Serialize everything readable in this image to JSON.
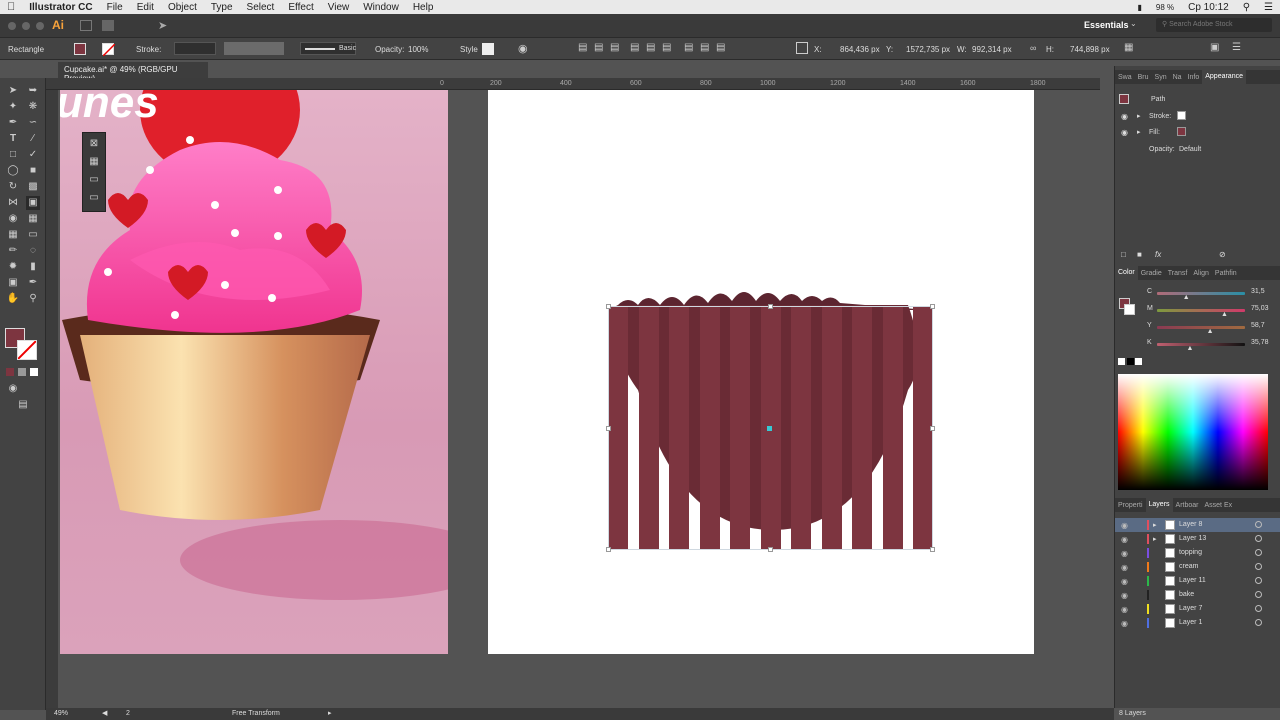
{
  "menubar": {
    "apple_icon": "apple-logo-icon",
    "app_name": "Illustrator CC",
    "items": [
      "File",
      "Edit",
      "Object",
      "Type",
      "Select",
      "Effect",
      "View",
      "Window",
      "Help"
    ],
    "battery": "98 %",
    "clock": "Ср 10:12"
  },
  "approw": {
    "ai_badge": "Ai",
    "workspace": "Essentials",
    "search_placeholder": "Search Adobe Stock"
  },
  "control": {
    "object_type": "Rectangle",
    "stroke_label": "Stroke:",
    "brush_label": "Basic",
    "opacity_label": "Opacity:",
    "opacity_value": "100%",
    "style_label": "Style",
    "x_label": "X:",
    "x_value": "864,436 px",
    "y_label": "Y:",
    "y_value": "1572,735 px",
    "w_label": "W:",
    "w_value": "992,314 px",
    "h_label": "H:",
    "h_value": "744,898 px"
  },
  "document": {
    "tab_title": "Cupcake.ai* @ 49% (RGB/GPU Preview)",
    "left_art_text": "unes",
    "ruler_labels": [
      "0",
      "200",
      "400",
      "600",
      "800",
      "1000",
      "1200",
      "1400",
      "1600",
      "1800"
    ]
  },
  "colors": {
    "fill": "#7d3540",
    "fill_dark": "#6a2b35",
    "wave": "#5c2530",
    "accent": "#37c9d3"
  },
  "appearance_panel": {
    "tabs": [
      "Swa",
      "Bru",
      "Syn",
      "Na",
      "Info",
      "Appearance"
    ],
    "active_tab": "Appearance",
    "object": "Path",
    "stroke_label": "Stroke:",
    "fill_label": "Fill:",
    "opacity_label": "Opacity:",
    "opacity_value": "Default"
  },
  "color_panel": {
    "tabs": [
      "Color",
      "Gradie",
      "Transf",
      "Align",
      "Pathfin"
    ],
    "active_tab": "Color",
    "channels": [
      {
        "name": "C",
        "value": "31,5",
        "level": 0.315
      },
      {
        "name": "M",
        "value": "75,03",
        "level": 0.7503
      },
      {
        "name": "Y",
        "value": "58,7",
        "level": 0.587
      },
      {
        "name": "K",
        "value": "35,78",
        "level": 0.3578
      }
    ]
  },
  "layers_panel": {
    "tabs": [
      "Properti",
      "Layers",
      "Artboar",
      "Asset Ex"
    ],
    "active_tab": "Layers",
    "layers": [
      {
        "name": "Layer 8",
        "color": "#e04f5f",
        "selected": true
      },
      {
        "name": "Layer 13",
        "color": "#e04f5f",
        "selected": false
      },
      {
        "name": "topping",
        "color": "#7a4ee0",
        "selected": false
      },
      {
        "name": "cream",
        "color": "#f07a1a",
        "selected": false
      },
      {
        "name": "Layer 11",
        "color": "#2bb84a",
        "selected": false
      },
      {
        "name": "bake",
        "color": "#222222",
        "selected": false
      },
      {
        "name": "Layer 7",
        "color": "#f0e020",
        "selected": false
      },
      {
        "name": "Layer 1",
        "color": "#4f6fe0",
        "selected": false
      }
    ],
    "count": "8 Layers"
  },
  "status": {
    "zoom": "49%",
    "page": "2",
    "tool": "Free Transform"
  }
}
